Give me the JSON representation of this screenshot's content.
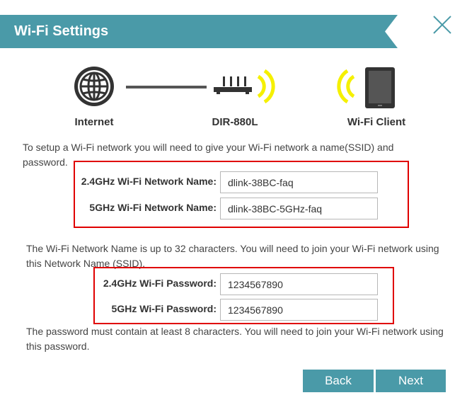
{
  "header": {
    "title": "Wi-Fi Settings"
  },
  "colors": {
    "accent": "#4a9aa8",
    "highlight": "#e00000",
    "signal": "#f5f000"
  },
  "icons": {
    "close": "close-icon",
    "internet": "globe-icon",
    "router": "router-icon",
    "client": "tablet-icon",
    "signal": "wifi-signal-icon"
  },
  "diagram": {
    "internet_label": "Internet",
    "router_label": "DIR-880L",
    "client_label": "Wi-Fi Client"
  },
  "intro_text": "To setup a Wi-Fi network you will need to give your Wi-Fi network a name(SSID) and password.",
  "ssid_fields": {
    "label_24": "2.4GHz Wi-Fi Network Name:",
    "value_24": "dlink-38BC-faq",
    "label_5": "5GHz Wi-Fi Network Name:",
    "value_5": "dlink-38BC-5GHz-faq"
  },
  "ssid_help": "The Wi-Fi Network Name is up to 32 characters. You will need to join your Wi-Fi network using this Network Name (SSID).",
  "password_fields": {
    "label_24": "2.4GHz Wi-Fi Password:",
    "value_24": "1234567890",
    "label_5": "5GHz Wi-Fi Password:",
    "value_5": "1234567890"
  },
  "password_help": "The password must contain at least 8 characters. You will need to join your Wi-Fi network using this password.",
  "buttons": {
    "back": "Back",
    "next": "Next"
  }
}
